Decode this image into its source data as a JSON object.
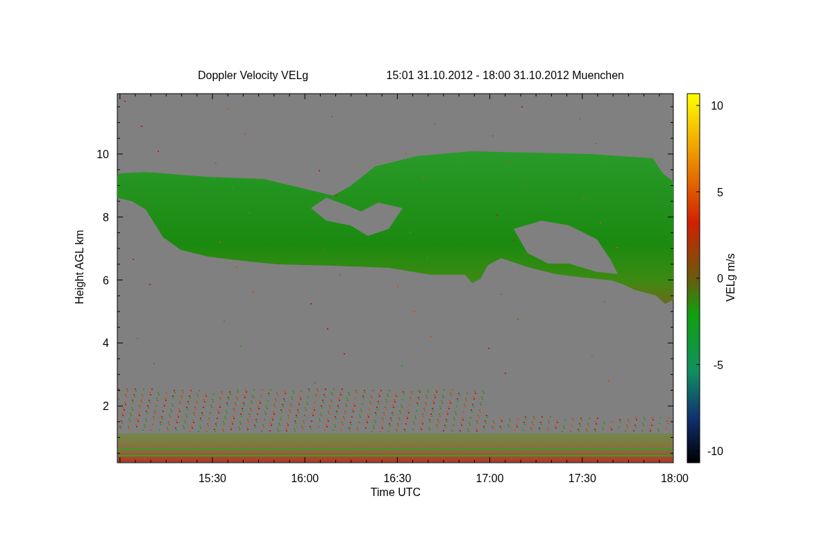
{
  "title": {
    "variable": "Doppler Velocity VELg",
    "period": "15:01 31.10.2012 - 18:00 31.10.2012 Muenchen"
  },
  "plot": {
    "xlabel": "Time UTC",
    "ylabel": "Height AGL km",
    "xticks": [
      "15:30",
      "16:00",
      "16:30",
      "17:00",
      "17:30",
      "18:00"
    ],
    "yticks": [
      "10",
      "8",
      "6",
      "4",
      "2"
    ]
  },
  "colorbar": {
    "label": "VELg m/s",
    "ticks": [
      "10",
      "5",
      "0",
      "-5",
      "-10"
    ]
  }
}
